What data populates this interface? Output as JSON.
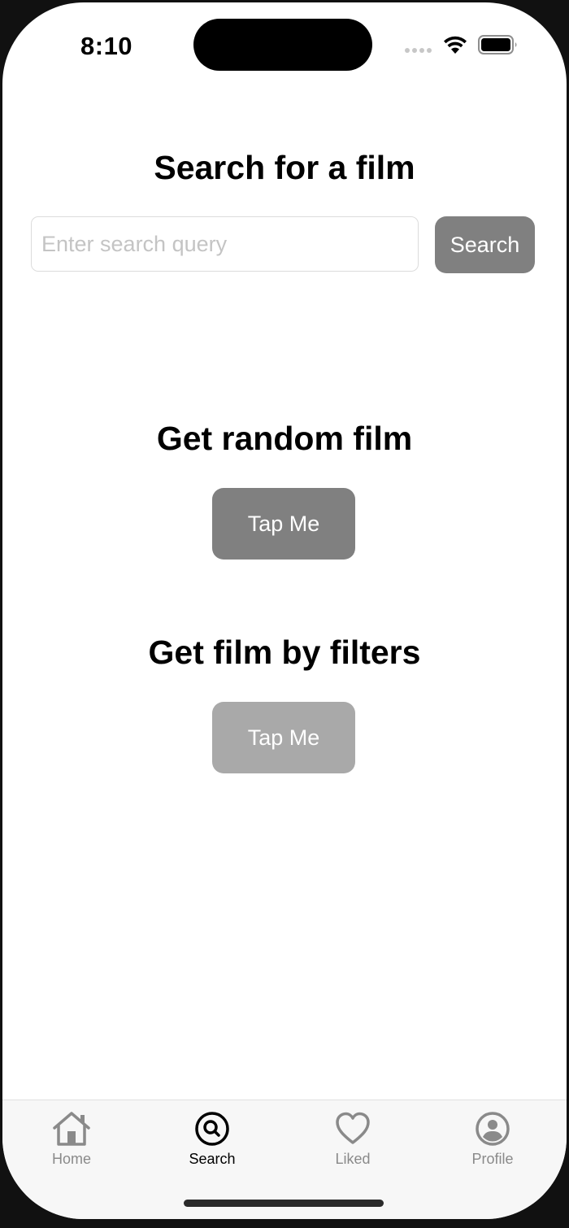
{
  "status_bar": {
    "time": "8:10"
  },
  "search_section": {
    "title": "Search for a film",
    "input_placeholder": "Enter search query",
    "input_value": "",
    "button_label": "Search"
  },
  "random_section": {
    "title": "Get random film",
    "button_label": "Tap Me"
  },
  "filters_section": {
    "title": "Get film by filters",
    "button_label": "Tap Me"
  },
  "tab_bar": {
    "items": [
      {
        "label": "Home",
        "icon": "house-icon",
        "active": false
      },
      {
        "label": "Search",
        "icon": "search-icon",
        "active": true
      },
      {
        "label": "Liked",
        "icon": "heart-icon",
        "active": false
      },
      {
        "label": "Profile",
        "icon": "person-circle-icon",
        "active": false
      }
    ]
  },
  "colors": {
    "primary_button": "#808080",
    "disabled_button": "#a9a9a9",
    "active_tab": "#000000",
    "inactive_tab": "#8a8a8a"
  }
}
